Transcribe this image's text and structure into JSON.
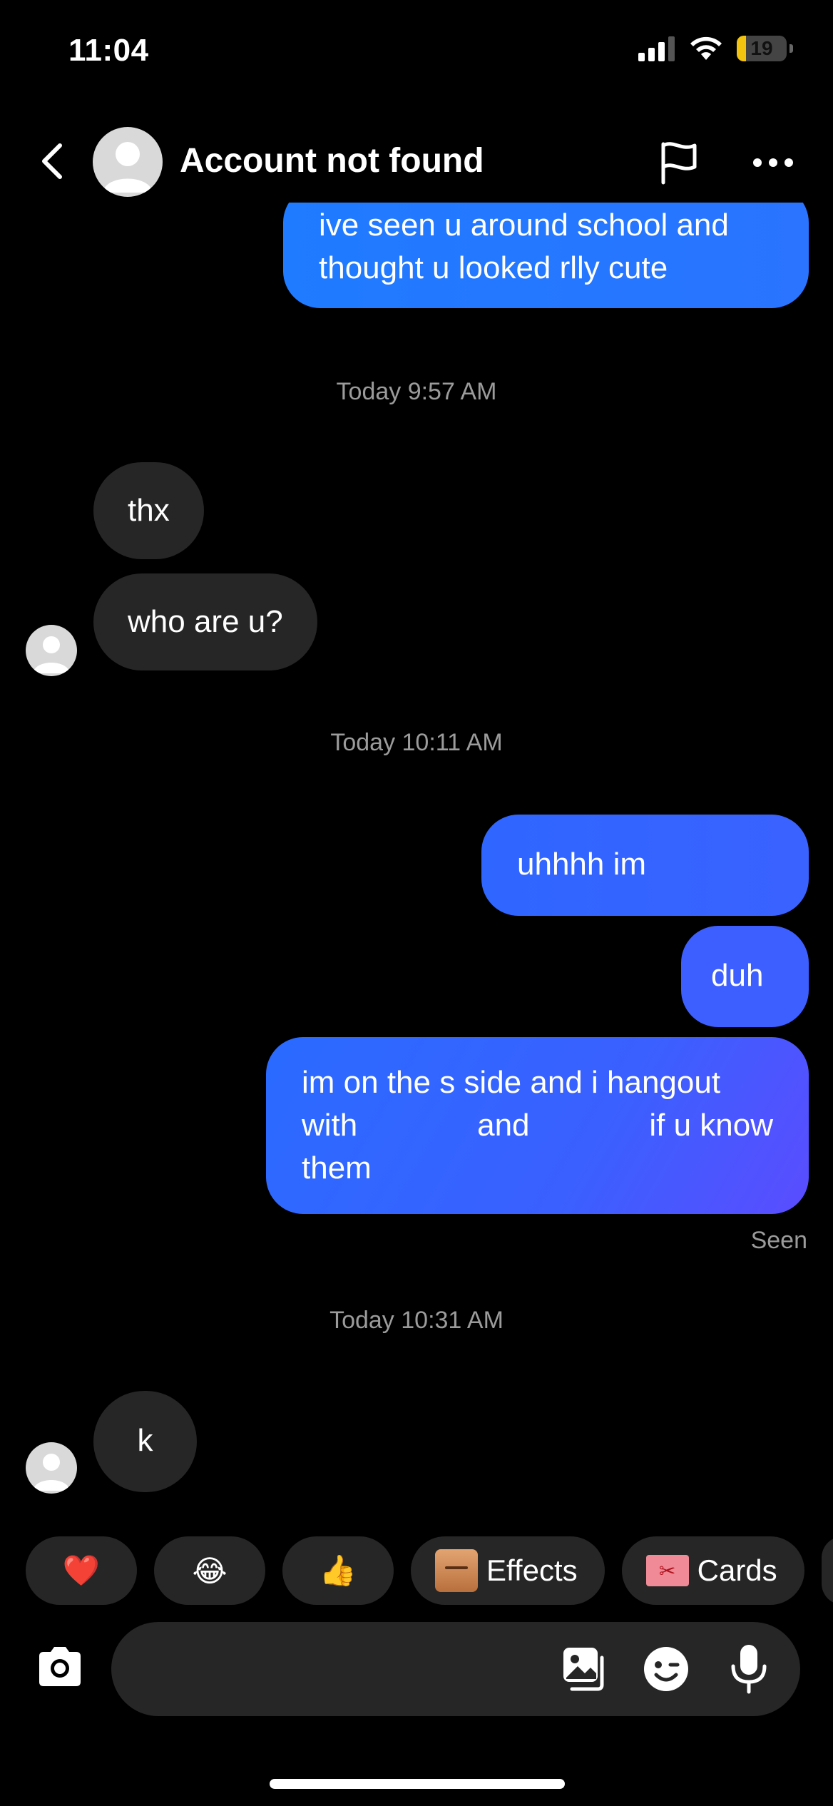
{
  "status_bar": {
    "time": "11:04",
    "battery": "19",
    "battery_level": 0.19,
    "battery_color": "#f2c40f"
  },
  "header": {
    "title": "Account not found"
  },
  "colors": {
    "background": "#000000",
    "incoming_bubble": "#262626",
    "outgoing_bubble_start": "#1f7bff",
    "outgoing_bubble_end": "#5b4dff",
    "timestamp": "#9b9b9b"
  },
  "messages": [
    {
      "sender": "me",
      "text": "ive seen u around school and thought u looked rlly cute"
    },
    {
      "type": "timestamp",
      "text": "Today 9:57 AM"
    },
    {
      "sender": "them",
      "text": "thx"
    },
    {
      "sender": "them",
      "text": "who are u?"
    },
    {
      "type": "timestamp",
      "text": "Today 10:11 AM"
    },
    {
      "sender": "me",
      "text": "uhhhh im"
    },
    {
      "sender": "me",
      "text": "duh"
    },
    {
      "sender": "me",
      "line1": "im on the s side and i hangout",
      "line2_a": "with",
      "line2_b": "and",
      "line2_c": "if u know",
      "line3": "them"
    },
    {
      "type": "status",
      "text": "Seen"
    },
    {
      "type": "timestamp",
      "text": "Today 10:31 AM"
    },
    {
      "sender": "them",
      "text": "k"
    }
  ],
  "quick_replies": [
    {
      "icon": "heart-emoji",
      "glyph": "❤️"
    },
    {
      "icon": "laughing-emoji",
      "glyph": "😂"
    },
    {
      "icon": "thumbs-up-emoji",
      "glyph": "👍"
    },
    {
      "icon": "effects-icon",
      "label": "Effects"
    },
    {
      "icon": "cards-icon",
      "label": "Cards"
    }
  ],
  "composer": {
    "placeholder": ""
  }
}
